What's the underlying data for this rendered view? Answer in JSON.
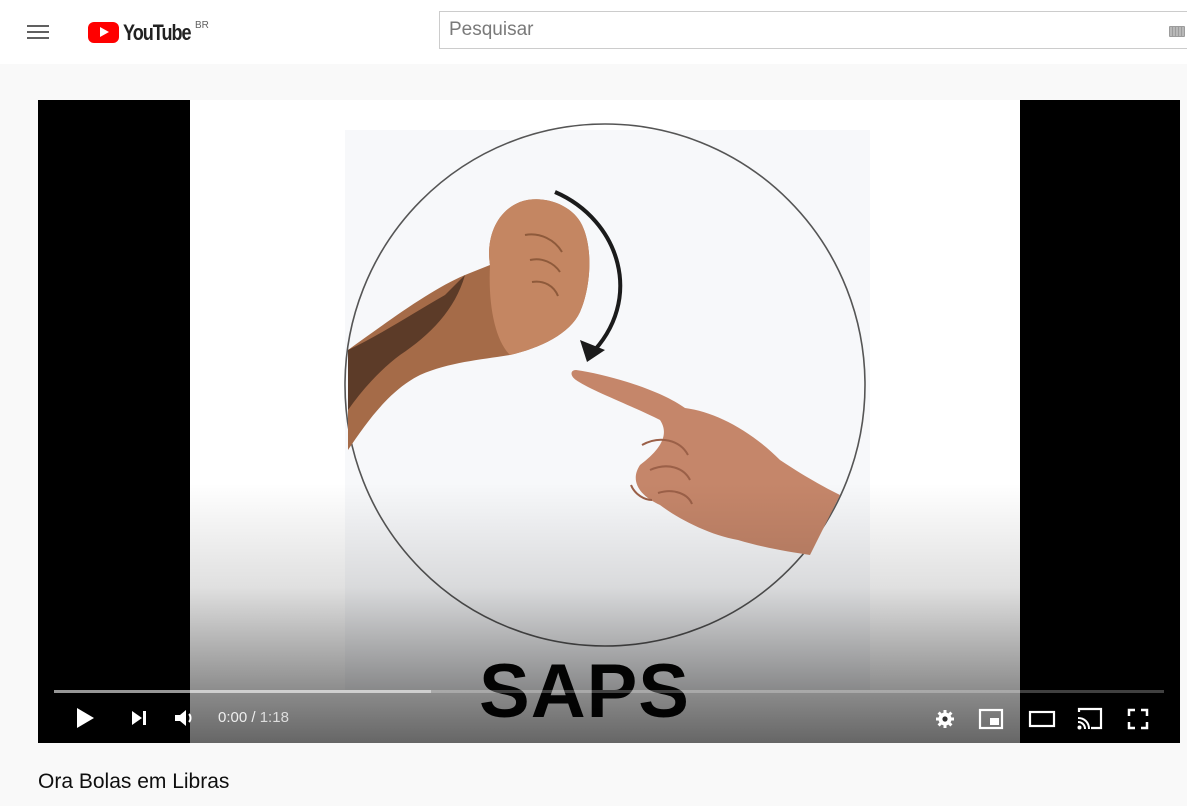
{
  "header": {
    "logo_text": "YouTube",
    "country_code": "BR",
    "search_placeholder": "Pesquisar",
    "icons": [
      "menu-icon",
      "keyboard-icon"
    ]
  },
  "player": {
    "video_text": "SAPS",
    "current_time": "0:00",
    "duration": "1:18",
    "time_separator": " / ",
    "buffered_fraction": 0.34,
    "played_fraction": 0.0,
    "controls": [
      "play-icon",
      "next-icon",
      "volume-icon",
      "settings-icon",
      "miniplayer-icon",
      "theater-icon",
      "cast-icon",
      "fullscreen-icon"
    ]
  },
  "video": {
    "title": "Ora Bolas em Libras"
  },
  "colors": {
    "brand": "#ff0000",
    "page_background": "#f9f9f9",
    "player_background": "#000000"
  }
}
